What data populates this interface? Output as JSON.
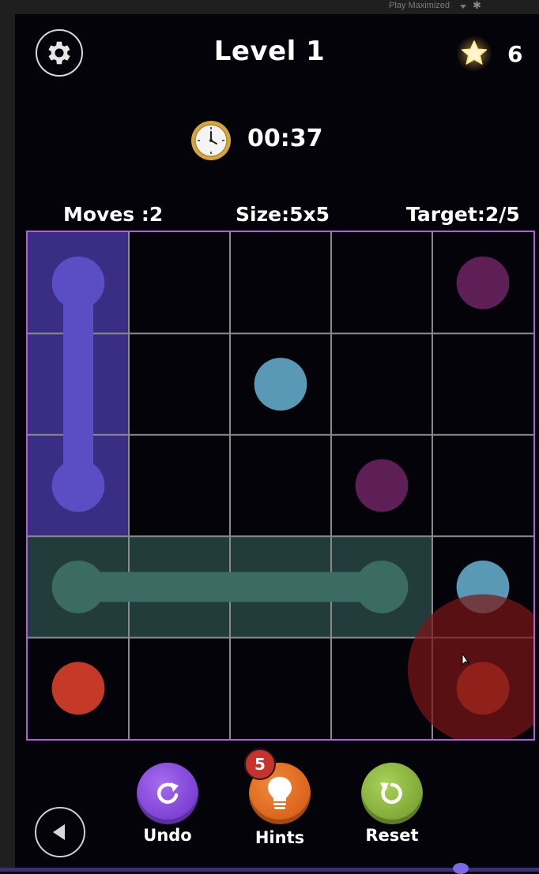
{
  "editor": {
    "play_mode_label": "Play Maximized"
  },
  "header": {
    "level_title": "Level 1",
    "star_count": "6",
    "timer": "00:37"
  },
  "stats": {
    "moves": "Moves :2",
    "size": "Size:5x5",
    "target": "Target:2/5"
  },
  "board": {
    "rows": 5,
    "cols": 5,
    "frame_color": "#b35ce0",
    "grid_color": "#8a8a8a",
    "dots": [
      {
        "row": 0,
        "col": 4,
        "color": "#5e1f57"
      },
      {
        "row": 1,
        "col": 2,
        "color": "#5a99b5"
      },
      {
        "row": 2,
        "col": 3,
        "color": "#5e1f57"
      },
      {
        "row": 3,
        "col": 4,
        "color": "#5a99b5"
      },
      {
        "row": 4,
        "col": 0,
        "color": "#c53a26"
      },
      {
        "row": 4,
        "col": 4,
        "color": "#c53a26"
      },
      {
        "row": 0,
        "col": 0,
        "color": "#5b4dc4"
      },
      {
        "row": 2,
        "col": 0,
        "color": "#5b4dc4"
      },
      {
        "row": 3,
        "col": 0,
        "color": "#3b6b62"
      },
      {
        "row": 3,
        "col": 3,
        "color": "#3b6b62"
      }
    ],
    "paths": [
      {
        "color": "#5b4dc4",
        "fill": "#3a2d84",
        "cells": [
          [
            0,
            0
          ],
          [
            1,
            0
          ],
          [
            2,
            0
          ]
        ]
      },
      {
        "color": "#3b6b62",
        "fill": "#223c3b",
        "cells": [
          [
            3,
            0
          ],
          [
            3,
            1
          ],
          [
            3,
            2
          ],
          [
            3,
            3
          ]
        ]
      }
    ],
    "touch_indicator": {
      "row": 4,
      "col": 4,
      "color": "#7a1616"
    }
  },
  "buttons": {
    "undo_label": "Undo",
    "hints_label": "Hints",
    "reset_label": "Reset",
    "hint_count": "5"
  }
}
